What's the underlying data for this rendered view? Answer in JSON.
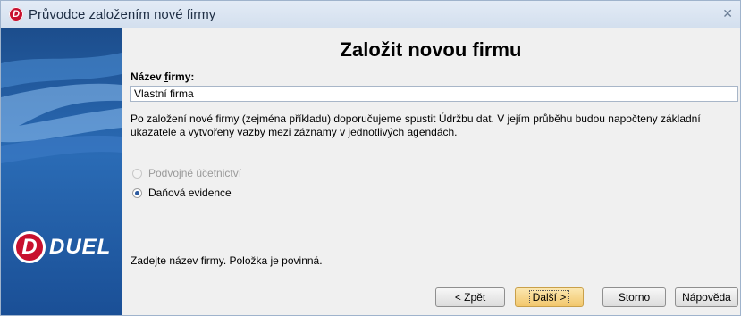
{
  "window": {
    "title": "Průvodce založením nové firmy",
    "close_label": "✕"
  },
  "sidebar": {
    "logo_letter": "D",
    "logo_text": "DUEL"
  },
  "page": {
    "title": "Založit novou firmu"
  },
  "form": {
    "name_label_prefix": "Název ",
    "name_label_underlined": "f",
    "name_label_suffix": "irmy:",
    "name_value": "Vlastní firma",
    "info": "Po založení nové firmy (zejména příkladu) doporučujeme spustit Údržbu dat. V jejím průběhu budou napočteny základní ukazatele a vytvořeny vazby mezi záznamy v jednotlivých agendách."
  },
  "options": [
    {
      "label": "Podvojné účetnictví",
      "checked": false,
      "disabled": true
    },
    {
      "label": "Daňová evidence",
      "checked": true,
      "disabled": false
    }
  ],
  "status": {
    "text": "Zadejte název firmy. Položka je povinná."
  },
  "buttons": {
    "back": "< Zpět",
    "next": "Další >",
    "cancel": "Storno",
    "help": "Nápověda"
  }
}
